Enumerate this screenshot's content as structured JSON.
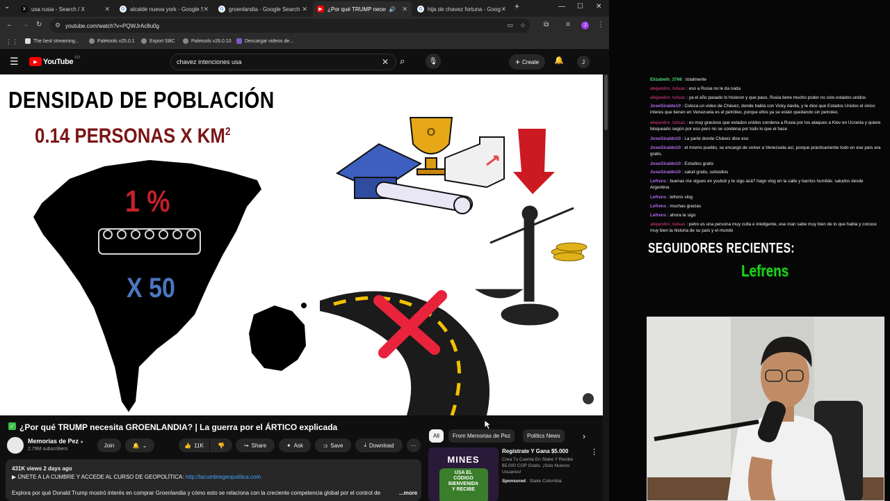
{
  "browser": {
    "tabs": [
      {
        "label": "usa rusia - Search / X",
        "icon": "x-logo-icon",
        "active": false
      },
      {
        "label": "alcalde nueva york - Google Se",
        "icon": "google-icon",
        "active": false
      },
      {
        "label": "groenlandia - Google Search",
        "icon": "google-icon",
        "active": false
      },
      {
        "label": "¿Por qué TRUMP neces",
        "icon": "youtube-icon",
        "active": true
      },
      {
        "label": "hija de chavez fortuna - Google",
        "icon": "google-icon",
        "active": false
      }
    ],
    "url": "youtube.com/watch?v=PQWJrAc8u0g",
    "bookmarks": [
      "The best streaming...",
      "Paletools v25.0.1",
      "Export SBC",
      "Paletools v26.0.10",
      "Descargar videos de..."
    ]
  },
  "youtube": {
    "logo_text": "YouTube",
    "country": "CO",
    "search_value": "chavez intenciones usa",
    "create_label": "Create",
    "avatar_letter": "J"
  },
  "video": {
    "heading": "DENSIDAD DE POBLACIÓN",
    "density": "0.14 PERSONAS X KM",
    "density_exp": "2",
    "percent": "1 %",
    "multiplier": "X 50",
    "trophy_letter": "O"
  },
  "meta": {
    "title": "¿Por qué TRUMP necesita GROENLANDIA? | La guerra por el ÁRTICO explicada",
    "channel": "Memorias de Pez",
    "subscribers": "2.79M subscribers",
    "join": "Join",
    "likes": "11K",
    "share": "Share",
    "ask": "Ask",
    "save": "Save",
    "download": "Download",
    "views_date": "431K views  2 days ago",
    "desc_line1": "▶ ÚNETE A LA CUMBRE Y ACCEDE AL CURSO DE GEOPOLÍTICA: ",
    "desc_link": "http://lacumbregeopolitica.com",
    "desc_line2": "Explora por qué Donald Trump mostró interés en comprar Groenlandia y cómo esto se relaciona con la creciente competencia global por el control de",
    "more": "...more"
  },
  "chips": [
    "All",
    "From Memorias de Pez",
    "Politics News"
  ],
  "ad": {
    "thumb_title": "MINES",
    "thumb_sub1": "USA EL",
    "thumb_sub2": "CÓDIGO",
    "thumb_sub3": "BIENVENIDA",
    "thumb_sub4": "Y RECIBE",
    "title": "Regístrate Y Gana $5.000",
    "desc": "Crea Tu Cuenta En Stake Y Recibe $5.000 COP Gratis. ¡Solo Nuevos Usuarios!",
    "sponsored": "Sponsored",
    "advertiser": "· Stake Colombia"
  },
  "chat": [
    {
      "user": "Elizabeth_3766",
      "color": "#4fd97a",
      "msg": " : totalmente"
    },
    {
      "user": "alejandro_tulsas",
      "color": "#b0306a",
      "msg": " : eso a Rusia no le da nada"
    },
    {
      "user": "alejandro_tulsas",
      "color": "#b0306a",
      "msg": " : ya el año pasado lo hicieron y que paso, Rusia tiene mucho poder no solo estados unidos"
    },
    {
      "user": "JoseGiraldo10",
      "color": "#b66ef0",
      "msg": " : Coloca un video de Chávez, donde habla con Vicky davila, y le dice que Estados Unidos el único interes que tienen en Venezuela es el petróleo, porque ellos ya se están quedando sin petroleo."
    },
    {
      "user": "alejandro_tulsas",
      "color": "#b0306a",
      "msg": " : es muy gracioso que estados unidos condena a Rusia por los ataques a Kiev en Ucrania y quiere bloquearlo según por eso pero no se condena por todo lo que el hace"
    },
    {
      "user": "JoseGiraldo10",
      "color": "#b66ef0",
      "msg": " : La parte donde Chávez dice eso"
    },
    {
      "user": "JoseGiraldo10",
      "color": "#b66ef0",
      "msg": " : el mismo pueblo, se encargó de volver a Venezuela así, porque prácticamente todo en ese país era gratis."
    },
    {
      "user": "JoseGiraldo10",
      "color": "#b66ef0",
      "msg": " : Estudios gratis"
    },
    {
      "user": "JoseGiraldo10",
      "color": "#b66ef0",
      "msg": " : salud gratis, subsidios"
    },
    {
      "user": "Lefrens",
      "color": "#b66ef0",
      "msg": " : buenas me sigues en youtub y te sigo acá? hago vlog en la calle y barrios humilde. saludos desde Argentina"
    },
    {
      "user": "Lefrens",
      "color": "#b66ef0",
      "msg": " : lefrens vlog"
    },
    {
      "user": "Lefrens",
      "color": "#b66ef0",
      "msg": " : muchas gracias"
    },
    {
      "user": "Lefrens",
      "color": "#b66ef0",
      "msg": " : ahora te sigo"
    },
    {
      "user": "alejandro_tulsas",
      "color": "#b0306a",
      "msg": " : petro es una persona muy culta e inteligente, ese man sabe muy bien de lo que habla y conoce muy bien la historia de su país y el mundo"
    }
  ],
  "overlay": {
    "recent_label": "SEGUIDORES RECIENTES:",
    "recent_follower": "Lefrens"
  }
}
